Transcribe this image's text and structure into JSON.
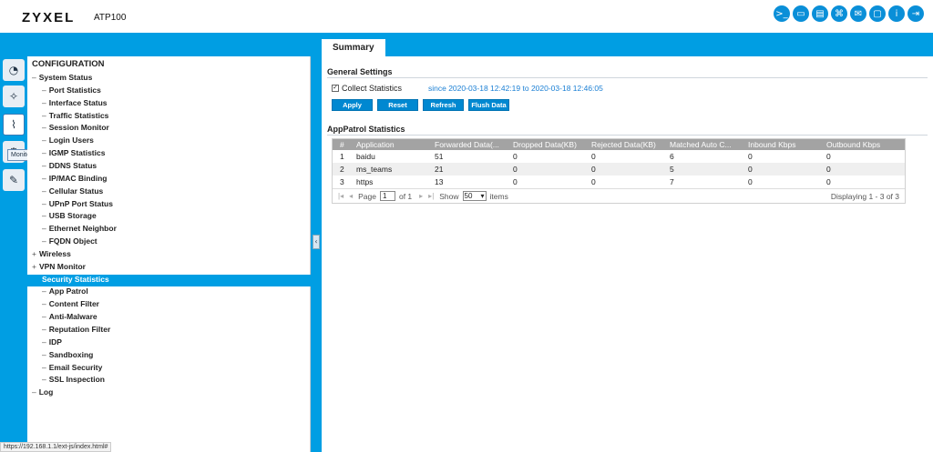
{
  "header": {
    "brand": "ZYXEL",
    "model": "ATP100",
    "icons": [
      {
        "name": "console-icon",
        "glyph": ">_"
      },
      {
        "name": "cli-icon",
        "glyph": "▭"
      },
      {
        "name": "save-icon",
        "glyph": "▤"
      },
      {
        "name": "network-icon",
        "glyph": "⌘"
      },
      {
        "name": "chat-icon",
        "glyph": "✉"
      },
      {
        "name": "book-icon",
        "glyph": "▢"
      },
      {
        "name": "info-icon",
        "glyph": "i"
      },
      {
        "name": "logout-icon",
        "glyph": "⇥"
      }
    ]
  },
  "tabs": [
    {
      "label": "Summary"
    }
  ],
  "rail": {
    "tooltip": "Monitor"
  },
  "nav": {
    "header": "CONFIGURATION",
    "items": [
      {
        "label": "System Status",
        "prefix": "–",
        "level": 1
      },
      {
        "label": "Port Statistics",
        "prefix": "–",
        "level": 2
      },
      {
        "label": "Interface Status",
        "prefix": "–",
        "level": 2
      },
      {
        "label": "Traffic Statistics",
        "prefix": "–",
        "level": 2
      },
      {
        "label": "Session Monitor",
        "prefix": "–",
        "level": 2
      },
      {
        "label": "Login Users",
        "prefix": "–",
        "level": 2
      },
      {
        "label": "IGMP Statistics",
        "prefix": "–",
        "level": 2
      },
      {
        "label": "DDNS Status",
        "prefix": "–",
        "level": 2
      },
      {
        "label": "IP/MAC Binding",
        "prefix": "–",
        "level": 2
      },
      {
        "label": "Cellular Status",
        "prefix": "–",
        "level": 2
      },
      {
        "label": "UPnP Port Status",
        "prefix": "–",
        "level": 2
      },
      {
        "label": "USB Storage",
        "prefix": "–",
        "level": 2
      },
      {
        "label": "Ethernet Neighbor",
        "prefix": "–",
        "level": 2
      },
      {
        "label": "FQDN Object",
        "prefix": "–",
        "level": 2
      },
      {
        "label": "Wireless",
        "prefix": "+",
        "level": 1
      },
      {
        "label": "VPN Monitor",
        "prefix": "+",
        "level": 1
      },
      {
        "label": "Security Statistics",
        "prefix": "",
        "level": 1,
        "selected": true
      },
      {
        "label": "App Patrol",
        "prefix": "–",
        "level": 2
      },
      {
        "label": "Content Filter",
        "prefix": "–",
        "level": 2
      },
      {
        "label": "Anti-Malware",
        "prefix": "–",
        "level": 2
      },
      {
        "label": "Reputation Filter",
        "prefix": "–",
        "level": 2
      },
      {
        "label": "IDP",
        "prefix": "–",
        "level": 2
      },
      {
        "label": "Sandboxing",
        "prefix": "–",
        "level": 2
      },
      {
        "label": "Email Security",
        "prefix": "–",
        "level": 2
      },
      {
        "label": "SSL Inspection",
        "prefix": "–",
        "level": 2
      },
      {
        "label": "Log",
        "prefix": "–",
        "level": 1
      }
    ]
  },
  "general": {
    "title": "General Settings",
    "collect_label": "Collect Statistics",
    "collect_checked": true,
    "since_text": "since 2020-03-18 12:42:19 to 2020-03-18 12:46:05",
    "buttons": {
      "apply": "Apply",
      "reset": "Reset",
      "refresh": "Refresh",
      "flush": "Flush Data"
    }
  },
  "apppatrol": {
    "title": "AppPatrol Statistics",
    "columns": [
      "#",
      "Application",
      "Forwarded Data(...",
      "Dropped Data(KB)",
      "Rejected Data(KB)",
      "Matched Auto C...",
      "Inbound Kbps",
      "Outbound Kbps"
    ],
    "rows": [
      [
        "1",
        "baidu",
        "51",
        "0",
        "0",
        "6",
        "0",
        "0"
      ],
      [
        "2",
        "ms_teams",
        "21",
        "0",
        "0",
        "5",
        "0",
        "0"
      ],
      [
        "3",
        "https",
        "13",
        "0",
        "0",
        "7",
        "0",
        "0"
      ]
    ],
    "pager": {
      "page_label": "Page",
      "page_value": "1",
      "of_label": "of 1",
      "show_label": "Show",
      "show_value": "50",
      "items_label": "items",
      "display_text": "Displaying 1 - 3 of 3"
    }
  },
  "statusbar": {
    "url": "https://192.168.1.1/ext-js/index.html#"
  }
}
